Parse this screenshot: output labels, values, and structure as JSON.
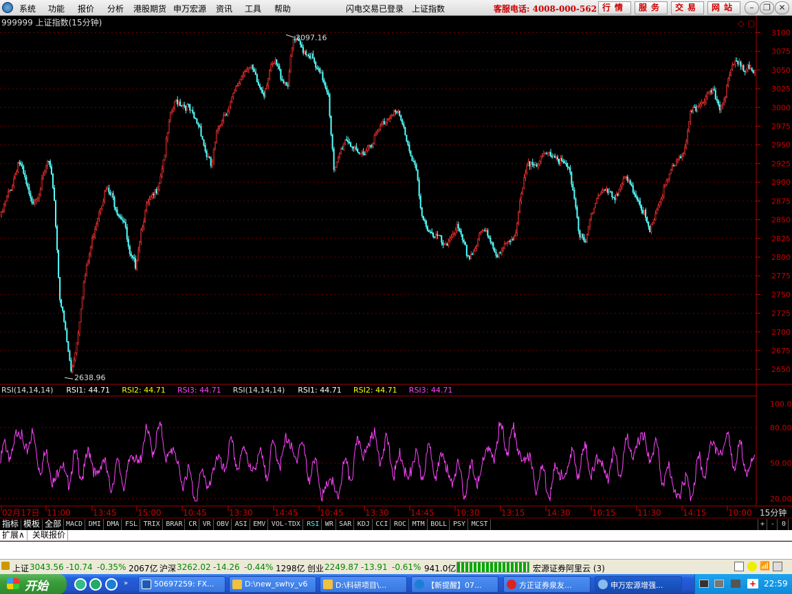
{
  "menu": {
    "items": [
      "系统",
      "功能",
      "报价",
      "分析",
      "港股期货",
      "申万宏源",
      "资讯",
      "工具",
      "帮助"
    ],
    "login_status": "闪电交易已登录",
    "index_name": "上证指数",
    "phone": "客服电话: 4008-000-562",
    "quick_buttons": [
      "行情",
      "服务",
      "交易",
      "网站"
    ]
  },
  "chart": {
    "title": "999999 上证指数(15分钟)",
    "high_label": "3097.16",
    "low_label": "2638.96",
    "rsi_header": [
      {
        "text": "RSI(14,14,14)",
        "color": "#dddddd"
      },
      {
        "text": "RSI1: 44.71",
        "color": "#ffffff"
      },
      {
        "text": "RSI2: 44.71",
        "color": "#ffff00"
      },
      {
        "text": "RSI3: 44.71",
        "color": "#ff44ff"
      },
      {
        "text": "RSI(14,14,14)",
        "color": "#dddddd"
      },
      {
        "text": "RSI1: 44.71",
        "color": "#ffffff"
      },
      {
        "text": "RSI2: 44.71",
        "color": "#ffff00"
      },
      {
        "text": "RSI3: 44.71",
        "color": "#ff44ff"
      }
    ],
    "period_label": "15分钟"
  },
  "chart_data": [
    {
      "type": "candlestick",
      "title": "999999 上证指数(15分钟)",
      "y_ticks": [
        3100,
        3075,
        3050,
        3025,
        3000,
        2975,
        2950,
        2925,
        2900,
        2875,
        2850,
        2825,
        2800,
        2775,
        2750,
        2725,
        2700,
        2675,
        2650
      ],
      "ylim": [
        2630,
        3105
      ],
      "x_ticks": [
        "02月17日",
        "11:00",
        "13:45",
        "15:00",
        "10:45",
        "13:30",
        "14:45",
        "10:45",
        "13:30",
        "14:45",
        "10:30",
        "13:15",
        "14:30",
        "10:15",
        "11:30",
        "14:15",
        "10:00"
      ],
      "close_path": [
        2855,
        2880,
        2900,
        2930,
        2905,
        2875,
        2880,
        2900,
        2930,
        2890,
        2750,
        2700,
        2645,
        2690,
        2760,
        2800,
        2840,
        2870,
        2890,
        2880,
        2860,
        2850,
        2800,
        2790,
        2840,
        2870,
        2880,
        2900,
        2940,
        2990,
        3010,
        3005,
        3000,
        2985,
        2975,
        2940,
        2920,
        2970,
        2990,
        3000,
        3020,
        3040,
        3055,
        3050,
        3030,
        3020,
        3050,
        3060,
        3040,
        3030,
        3090,
        3085,
        3075,
        3070,
        3050,
        3040,
        3020,
        2910,
        2940,
        2960,
        2950,
        2935,
        2940,
        2950,
        2960,
        2975,
        2985,
        2995,
        2990,
        2970,
        2940,
        2920,
        2850,
        2840,
        2830,
        2825,
        2810,
        2830,
        2840,
        2820,
        2800,
        2810,
        2830,
        2835,
        2820,
        2800,
        2810,
        2825,
        2830,
        2880,
        2920,
        2930,
        2925,
        2935,
        2940,
        2935,
        2925,
        2920,
        2890,
        2830,
        2815,
        2860,
        2880,
        2890,
        2885,
        2880,
        2895,
        2905,
        2890,
        2880,
        2860,
        2830,
        2860,
        2880,
        2900,
        2920,
        2935,
        2940,
        2990,
        3000,
        3010,
        3015,
        3020,
        3000,
        3020,
        3050,
        3065,
        3055,
        3050,
        3045
      ]
    },
    {
      "type": "line",
      "title": "RSI(14,14,14)",
      "y_ticks": [
        100,
        80,
        50,
        20
      ],
      "ylim": [
        15,
        105
      ],
      "series": [
        {
          "name": "RSI1",
          "last": 44.71
        },
        {
          "name": "RSI2",
          "last": 44.71
        },
        {
          "name": "RSI3",
          "last": 44.71
        }
      ]
    }
  ],
  "indicators": [
    "指标",
    "模板",
    "全部",
    "MACD",
    "DMI",
    "DMA",
    "FSL",
    "TRIX",
    "BRAR",
    "CR",
    "VR",
    "OBV",
    "ASI",
    "EMV",
    "VOL-TDX",
    "RSI",
    "WR",
    "SAR",
    "KDJ",
    "CCI",
    "ROC",
    "MTM",
    "BOLL",
    "PSY",
    "MCST"
  ],
  "selected_indicator": "RSI",
  "bottom_tabs": [
    "扩展∧",
    "关联报价"
  ],
  "status": {
    "sh_name": "上证",
    "sh_value": "3043.56",
    "sh_change": "-10.74",
    "sh_pct": "-0.35%",
    "sh_vol": "2067亿",
    "hs_name": "沪深",
    "hs_value": "3262.02",
    "hs_change": "-14.26",
    "hs_pct": "-0.44%",
    "hs_vol": "1298亿",
    "cy_name": "创业",
    "cy_value": "2249.87",
    "cy_change": "-13.91",
    "cy_pct": "-0.61%",
    "cy_vol": "941.0亿",
    "server": "宏源证券阿里云 (3)"
  },
  "taskbar": {
    "start": "开始",
    "tasks": [
      "50697259: FX...",
      "D:\\new_swhy_v6",
      "D:\\科研项目\\...",
      "【新提醒】07...",
      "方正证券泉友...",
      "申万宏源增强..."
    ],
    "clock": "22:59"
  }
}
